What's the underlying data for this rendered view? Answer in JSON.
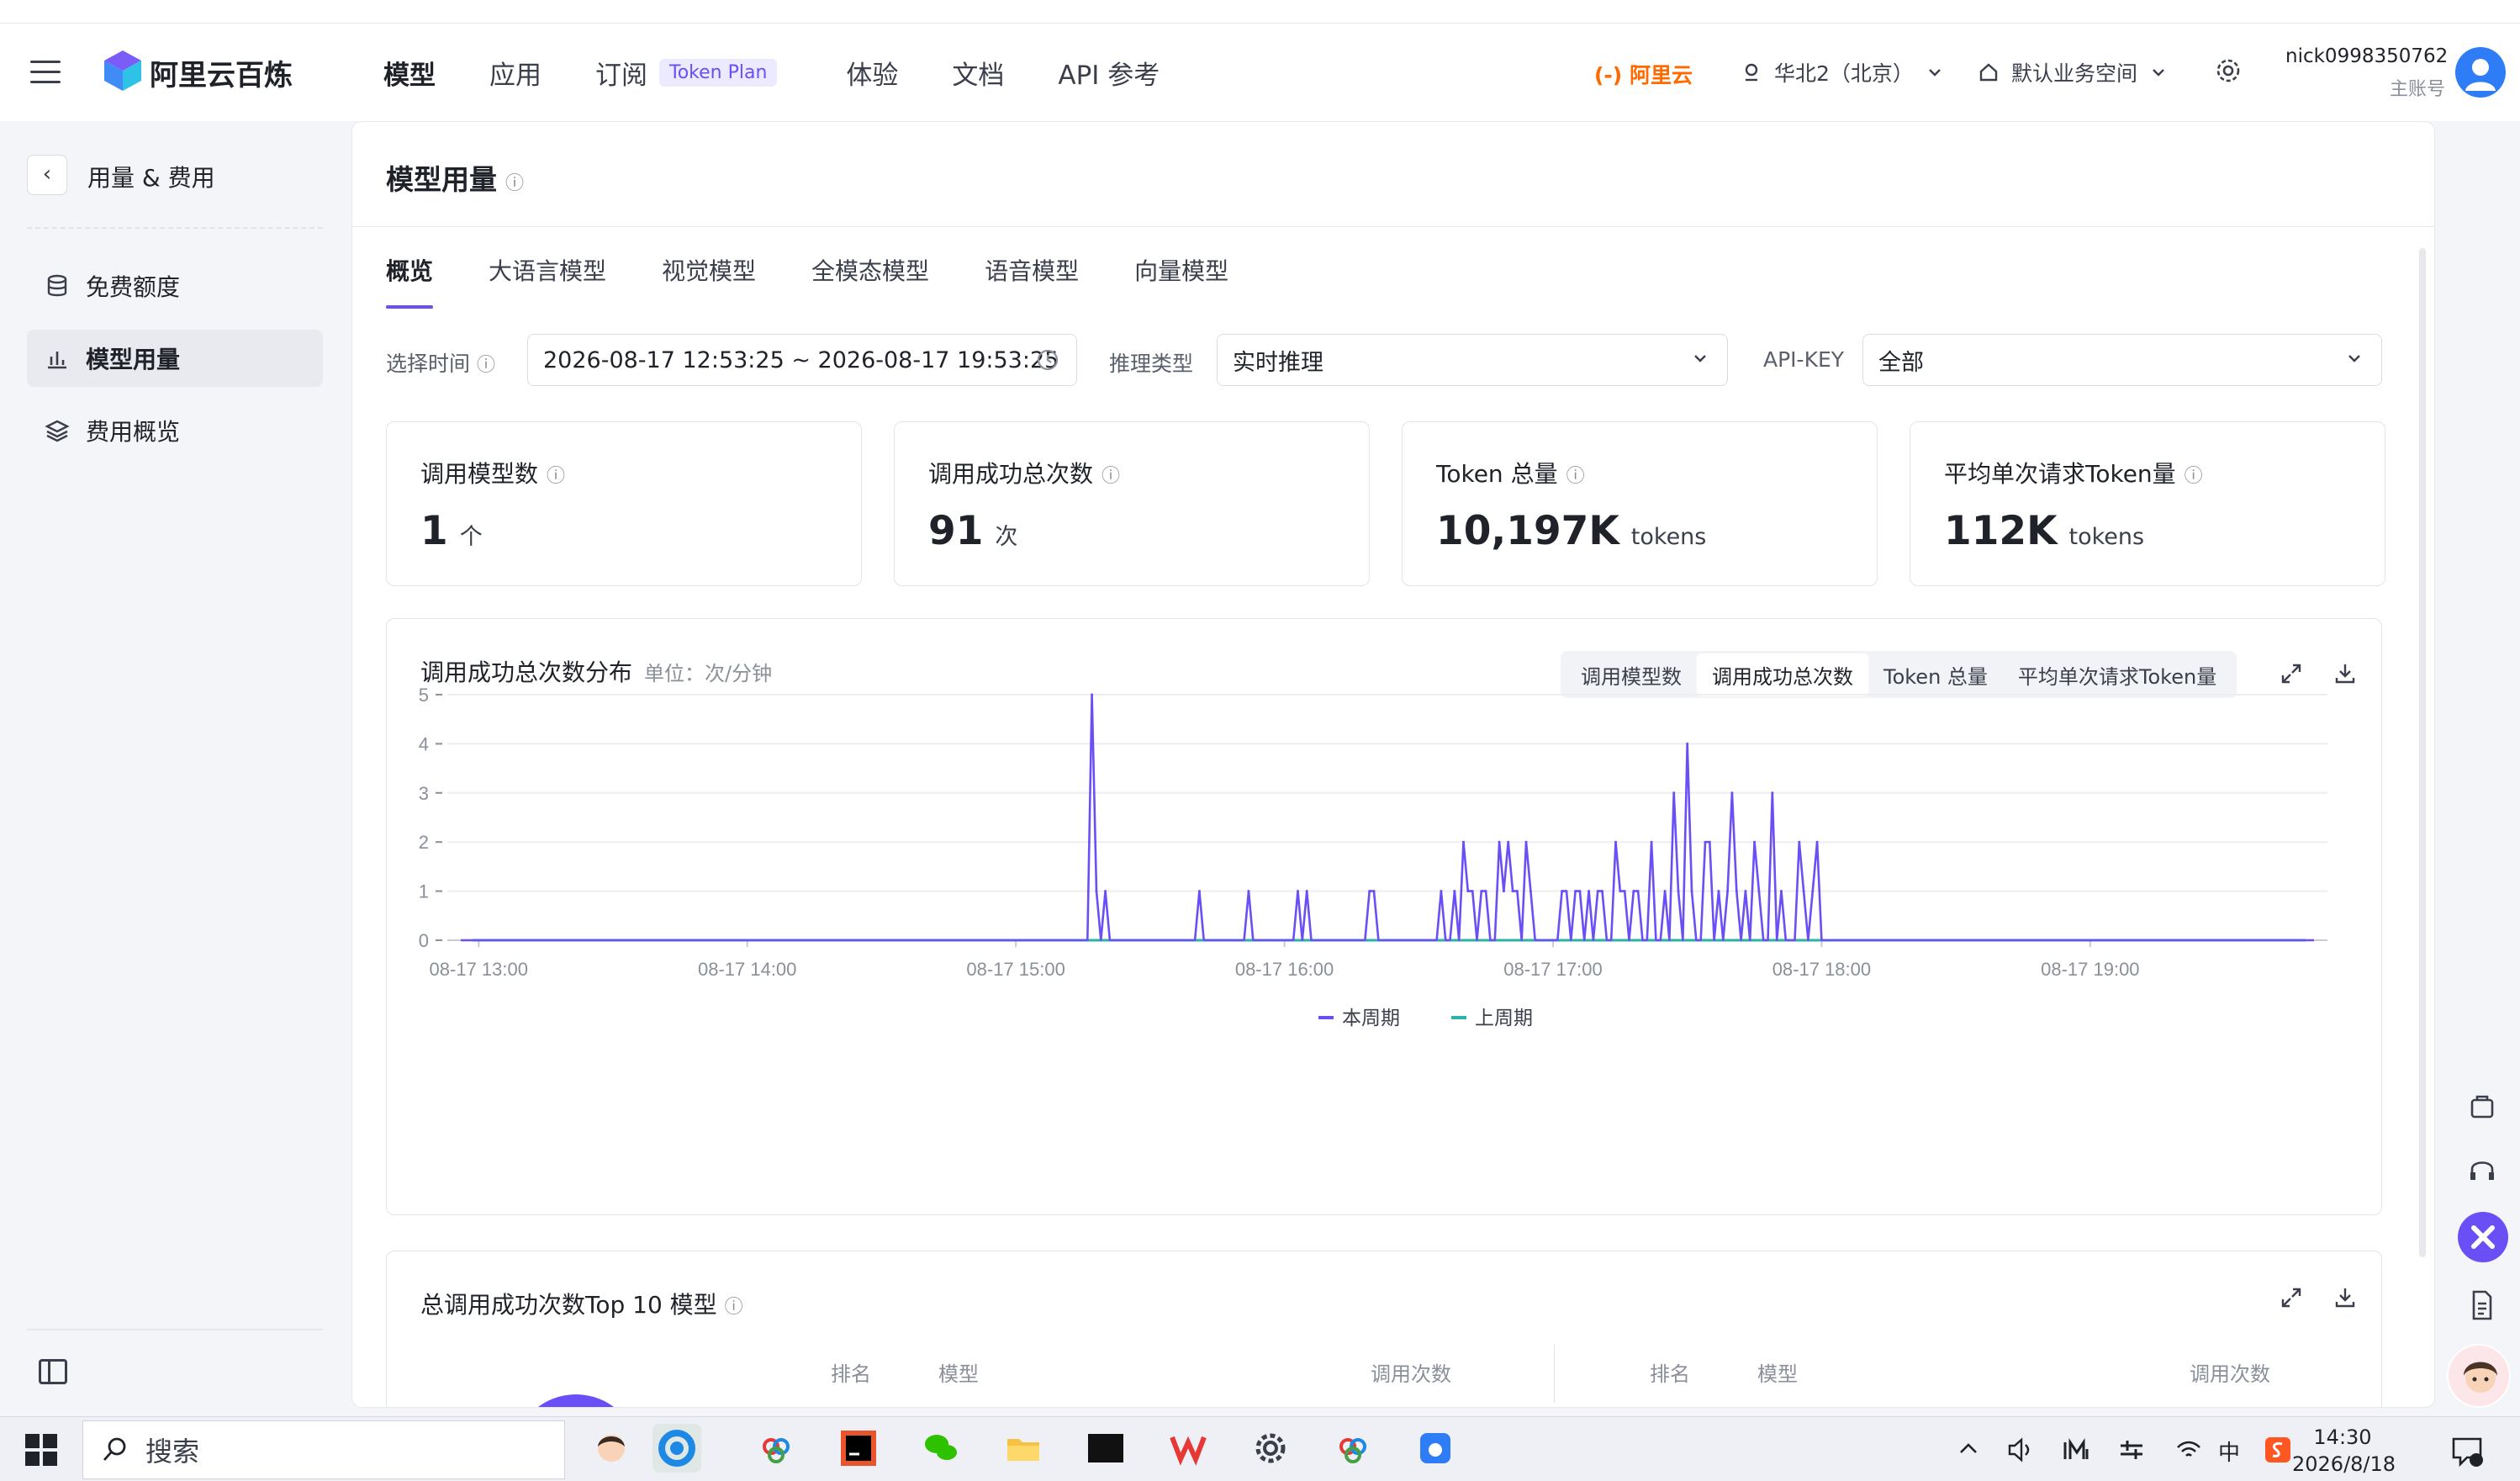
{
  "app": {
    "brand": "阿里云百炼"
  },
  "nav": {
    "items": [
      "模型",
      "应用",
      "订阅",
      "体验",
      "文档",
      "API 参考"
    ],
    "token_badge": "Token Plan",
    "aliyun": "阿里云",
    "region": "华北2（北京）",
    "workspace": "默认业务空间",
    "username": "nick0998350762",
    "role": "主账号"
  },
  "sidebar": {
    "title": "用量 & 费用",
    "items": [
      {
        "label": "免费额度",
        "icon": "database-icon"
      },
      {
        "label": "模型用量",
        "icon": "bar-chart-icon"
      },
      {
        "label": "费用概览",
        "icon": "layers-icon"
      }
    ]
  },
  "page": {
    "title": "模型用量",
    "tabs": [
      "概览",
      "大语言模型",
      "视觉模型",
      "全模态模型",
      "语音模型",
      "向量模型"
    ]
  },
  "filters": {
    "time_label": "选择时间",
    "time_value": "2026-08-17 12:53:25 ~ 2026-08-17 19:53:25",
    "type_label": "推理类型",
    "type_value": "实时推理",
    "key_label": "API-KEY",
    "key_value": "全部"
  },
  "stats": [
    {
      "title": "调用模型数",
      "value": "1",
      "unit": "个"
    },
    {
      "title": "调用成功总次数",
      "value": "91",
      "unit": "次"
    },
    {
      "title": "Token 总量",
      "value": "10,197K",
      "unit": "tokens"
    },
    {
      "title": "平均单次请求Token量",
      "value": "112K",
      "unit": "tokens"
    }
  ],
  "chart_panel": {
    "title": "调用成功总次数分布",
    "unit": "单位：次/分钟",
    "segments": [
      "调用模型数",
      "调用成功总次数",
      "Token 总量",
      "平均单次请求Token量"
    ],
    "active_segment": 1
  },
  "chart_data": {
    "type": "line",
    "ylim": [
      0,
      5
    ],
    "yticks": [
      0,
      1,
      2,
      3,
      4,
      5
    ],
    "xticks": [
      "08-17 13:00",
      "08-17 14:00",
      "08-17 15:00",
      "08-17 16:00",
      "08-17 17:00",
      "08-17 18:00",
      "08-17 19:00"
    ],
    "x_range": [
      "08-17 12:53",
      "08-17 19:53"
    ],
    "series": [
      {
        "name": "本周期",
        "color": "#6b4ff6",
        "points": [
          [
            "08-17 15:17",
            5
          ],
          [
            "08-17 15:18",
            1
          ],
          [
            "08-17 15:20",
            1
          ],
          [
            "08-17 15:41",
            1
          ],
          [
            "08-17 15:52",
            1
          ],
          [
            "08-17 16:03",
            1
          ],
          [
            "08-17 16:05",
            1
          ],
          [
            "08-17 16:19",
            1
          ],
          [
            "08-17 16:20",
            1
          ],
          [
            "08-17 16:35",
            1
          ],
          [
            "08-17 16:38",
            1
          ],
          [
            "08-17 16:40",
            2
          ],
          [
            "08-17 16:41",
            1
          ],
          [
            "08-17 16:42",
            1
          ],
          [
            "08-17 16:44",
            1
          ],
          [
            "08-17 16:45",
            1
          ],
          [
            "08-17 16:48",
            2
          ],
          [
            "08-17 16:49",
            1
          ],
          [
            "08-17 16:50",
            2
          ],
          [
            "08-17 16:51",
            1
          ],
          [
            "08-17 16:52",
            1
          ],
          [
            "08-17 16:54",
            2
          ],
          [
            "08-17 16:55",
            1
          ],
          [
            "08-17 17:02",
            1
          ],
          [
            "08-17 17:03",
            1
          ],
          [
            "08-17 17:05",
            1
          ],
          [
            "08-17 17:06",
            1
          ],
          [
            "08-17 17:08",
            1
          ],
          [
            "08-17 17:10",
            1
          ],
          [
            "08-17 17:11",
            1
          ],
          [
            "08-17 17:14",
            2
          ],
          [
            "08-17 17:15",
            1
          ],
          [
            "08-17 17:16",
            1
          ],
          [
            "08-17 17:18",
            1
          ],
          [
            "08-17 17:19",
            1
          ],
          [
            "08-17 17:22",
            2
          ],
          [
            "08-17 17:25",
            1
          ],
          [
            "08-17 17:27",
            3
          ],
          [
            "08-17 17:28",
            1
          ],
          [
            "08-17 17:30",
            4
          ],
          [
            "08-17 17:31",
            1
          ],
          [
            "08-17 17:34",
            2
          ],
          [
            "08-17 17:35",
            2
          ],
          [
            "08-17 17:37",
            1
          ],
          [
            "08-17 17:39",
            1
          ],
          [
            "08-17 17:40",
            3
          ],
          [
            "08-17 17:41",
            1
          ],
          [
            "08-17 17:43",
            1
          ],
          [
            "08-17 17:45",
            2
          ],
          [
            "08-17 17:46",
            1
          ],
          [
            "08-17 17:49",
            3
          ],
          [
            "08-17 17:51",
            1
          ],
          [
            "08-17 17:55",
            2
          ],
          [
            "08-17 17:56",
            1
          ],
          [
            "08-17 17:58",
            1
          ],
          [
            "08-17 17:59",
            2
          ]
        ]
      },
      {
        "name": "上周期",
        "color": "#2cb3a6",
        "points": []
      }
    ]
  },
  "top10": {
    "title": "总调用成功次数Top 10 模型",
    "headers": [
      "排名",
      "模型",
      "调用次数"
    ]
  },
  "taskbar": {
    "search": "搜索",
    "time": "14:30",
    "date": "2026/8/18"
  }
}
